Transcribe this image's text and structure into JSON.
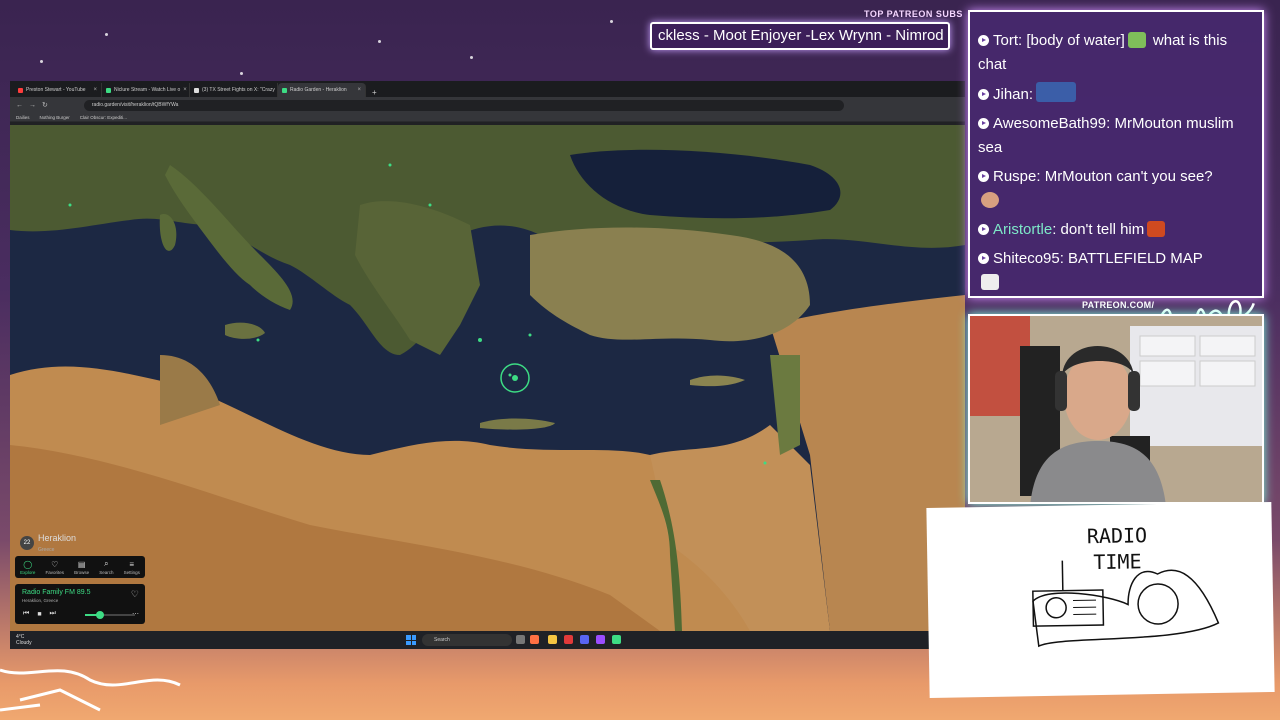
{
  "overlay": {
    "patreon_title": "TOP PATREON SUBS",
    "patreon_ticker": "ckless - Moot Enjoyer -Lex Wrynn - Nimrod",
    "patreon_url": "PATREON.COM/",
    "brand_text": "Anything Else"
  },
  "browser": {
    "tabs": [
      {
        "label": "Preston Stewart - YouTube",
        "color": "#ff3d3d"
      },
      {
        "label": "Niclure Stream - Watch Live o",
        "color": "#3ddc84"
      },
      {
        "label": "(3) TX Street Fights on X: \"Crazy",
        "color": "#dddddd"
      },
      {
        "label": "Radio Garden - Heraklion",
        "color": "#3ddc84",
        "active": true
      }
    ],
    "new_tab": "+",
    "url": "radio.garden/visit/heraklion/tQBWfYWa",
    "bookmarks": [
      "Dailies",
      "Nothing Burger",
      "Clair Obscur: Expediti..."
    ]
  },
  "radio_garden": {
    "place_badge": "22",
    "place_name": "Heraklion",
    "place_country": "Greece",
    "nav": [
      {
        "label": "Explore",
        "icon": "compass-icon",
        "glyph": "◯",
        "active": true
      },
      {
        "label": "Favorites",
        "icon": "heart-icon",
        "glyph": "♡"
      },
      {
        "label": "Browse",
        "icon": "browse-icon",
        "glyph": "▤"
      },
      {
        "label": "Search",
        "icon": "search-icon",
        "glyph": "⌕"
      },
      {
        "label": "Settings",
        "icon": "menu-icon",
        "glyph": "≡"
      }
    ],
    "station": "Radio Family FM 89.5",
    "station_location": "Heraklion, Greece",
    "volume": 0.3
  },
  "taskbar": {
    "weather_temp": "4°C",
    "weather_cond": "Cloudy",
    "search_label": "Search"
  },
  "chat": [
    {
      "user": "Tort",
      "text": ": [body of water]",
      "after": " what is this chat",
      "emote": "#7fbf5a"
    },
    {
      "user": "Jihan",
      "text": ":",
      "emote": "#3b5ea8"
    },
    {
      "user": "AwesomeBath99",
      "text": ": MrMouton muslim sea"
    },
    {
      "user": "Ruspe",
      "text": ": MrMouton can't you see?",
      "emote_line": "#d8a080"
    },
    {
      "user": "Aristortle",
      "text": ": don't tell him",
      "emote": "#d04a20",
      "alt": true
    },
    {
      "user": "Shiteco95",
      "text": ": BATTLEFIELD MAP",
      "emote_line": "#ffffff"
    }
  ],
  "card": {
    "title_line1": "RADIO",
    "title_line2": "TIME"
  }
}
